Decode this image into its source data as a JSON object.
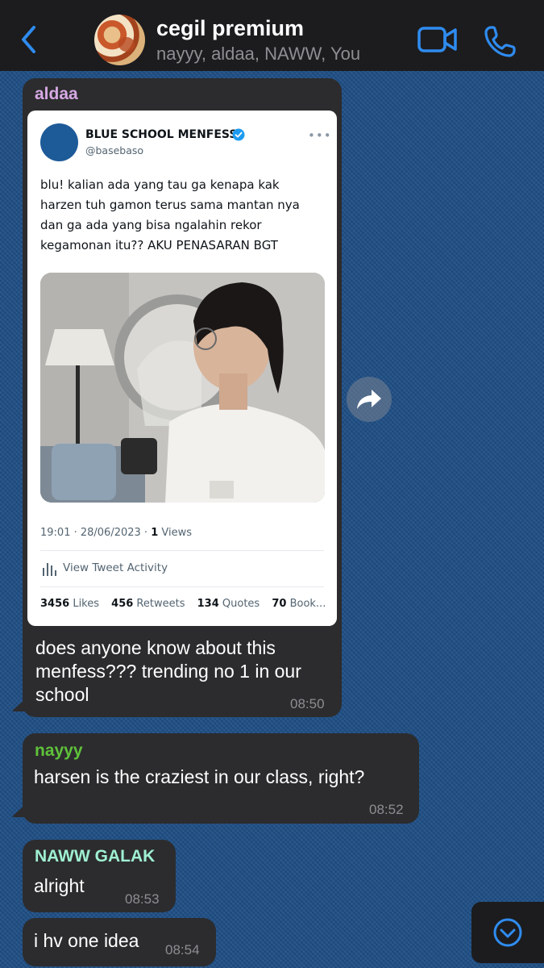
{
  "header": {
    "back_icon": "chevron-left-icon",
    "title": "cegil premium",
    "subtitle": "nayyy, aldaa, NAWW, You",
    "video_icon": "video-camera-icon",
    "call_icon": "phone-icon",
    "accent_color": "#2f8cf0"
  },
  "messages": [
    {
      "sender": "aldaa",
      "sender_color": "#d6a9e3",
      "tweet": {
        "account_name": "BLUE SCHOOL MENFESS",
        "handle": "@basebaso",
        "text_lines": [
          "blu! kalian ada yang tau ga kenapa kak",
          "harzen tuh gamon terus sama mantan nya",
          "dan ga ada yang bisa ngalahin rekor",
          "kegamonan itu?? AKU PENASARAN BGT"
        ],
        "date": "19:01 · 28/06/2023 · ",
        "views_count": "1",
        "views_label": " Views",
        "activity_label": "View Tweet Activity",
        "likes_count": "3456",
        "likes_label": " Likes",
        "retweets_count": "456",
        "retweets_label": " Retweets",
        "quotes_count": "134",
        "quotes_label": " Quotes",
        "bookmarks_count": "70",
        "bookmarks_label": " Book..."
      },
      "text_lines": [
        "does anyone know about this",
        "menfess??? trending no 1 in our",
        "school"
      ],
      "time": "08:50"
    },
    {
      "sender": "nayyy",
      "sender_color": "#5fc23a",
      "text": "harsen is the craziest in our class, right?",
      "time": "08:52"
    },
    {
      "sender": "NAWW GALAK",
      "sender_color": "#9ff0d2",
      "text": "alright",
      "time": "08:53"
    },
    {
      "text": "i hv one idea",
      "time": "08:54"
    }
  ],
  "controls": {
    "forward_icon": "forward-arrow-icon",
    "scroll_down_icon": "chevron-down-circle-icon"
  }
}
